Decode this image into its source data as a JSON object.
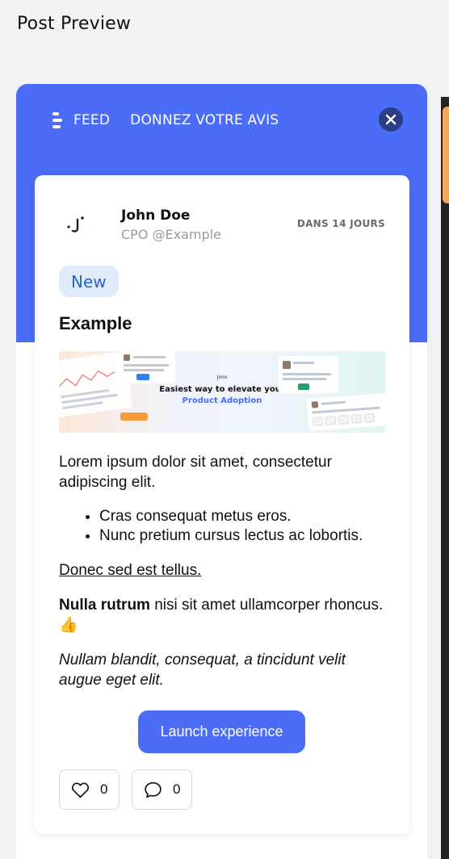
{
  "page": {
    "title": "Post Preview"
  },
  "widget": {
    "nav": {
      "feed_label": "FEED",
      "feedback_label": "DONNEZ VOTRE AVIS"
    },
    "colors": {
      "header": "#4a6cf7",
      "close_button": "#2c3e8a",
      "badge_bg": "#e1ecfb",
      "badge_text": "#2a63c9"
    }
  },
  "post": {
    "author": {
      "name": "John Doe",
      "role": "CPO @Example"
    },
    "date": "DANS 14 JOURS",
    "badge": "New",
    "title": "Example",
    "banner": {
      "headline": "Easiest way to elevate your",
      "subheadline": "Product Adoption",
      "logo": "jimo"
    },
    "body": {
      "paragraph1": "Lorem ipsum dolor sit amet, consectetur adipiscing elit.",
      "list": [
        "Cras consequat metus eros.",
        "Nunc pretium cursus lectus ac lobortis."
      ],
      "underlined": "Donec sed est tellus.",
      "bold_part": "Nulla rutrum",
      "rest_part": " nisi sit amet ullamcorper rhoncus. ",
      "emoji": "👍",
      "italic": "Nullam blandit, consequat, a tincidunt velit augue eget elit."
    },
    "cta_label": "Launch experience",
    "likes": "0",
    "comments": "0"
  }
}
